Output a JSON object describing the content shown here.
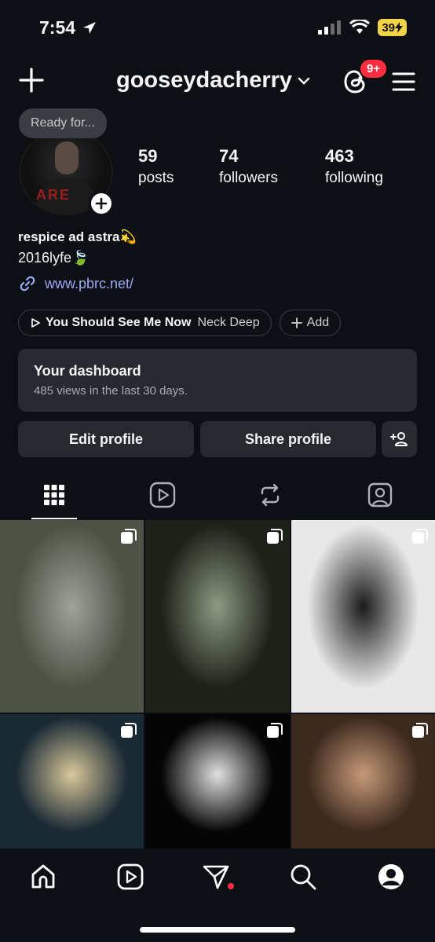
{
  "status_bar": {
    "time": "7:54",
    "battery": "39"
  },
  "header": {
    "username": "gooseydacherry",
    "notification_badge": "9+"
  },
  "profile": {
    "note": "Ready for...",
    "avatar_shirt_text": "ARE",
    "stats": [
      {
        "value": "59",
        "label": "posts"
      },
      {
        "value": "74",
        "label": "followers"
      },
      {
        "value": "463",
        "label": "following"
      }
    ],
    "bio_name": "respice ad astra",
    "bio_name_emoji": "💫",
    "bio_line": "2016lyfe",
    "bio_line_emoji": "🍃",
    "link": "www.pbrc.net/"
  },
  "music": {
    "song": "You Should See Me Now",
    "artist": "Neck Deep",
    "add_label": "Add"
  },
  "dashboard": {
    "title": "Your dashboard",
    "subtitle": "485 views in the last 30 days."
  },
  "actions": {
    "edit": "Edit profile",
    "share": "Share profile"
  },
  "tabs": [
    "grid-icon",
    "reels-icon",
    "reposts-icon",
    "tagged-icon"
  ],
  "grid": [
    {
      "desc": "camo mask forest",
      "colors": [
        "#4c5245",
        "#9ea39a"
      ]
    },
    {
      "desc": "night vision masks",
      "colors": [
        "#1d2119",
        "#8c9a82"
      ]
    },
    {
      "desc": "manga ink",
      "colors": [
        "#e8e8e8",
        "#1a1a1a"
      ]
    },
    {
      "desc": "moon through branches",
      "colors": [
        "#1a2a35",
        "#d9c89a"
      ]
    },
    {
      "desc": "pale face dark",
      "colors": [
        "#050505",
        "#e0e0e0"
      ]
    },
    {
      "desc": "boy glasses lighter",
      "colors": [
        "#3d2a1f",
        "#c79a78"
      ]
    }
  ],
  "nav": [
    "home-icon",
    "reels-icon",
    "messages-icon",
    "search-icon",
    "profile-icon"
  ]
}
